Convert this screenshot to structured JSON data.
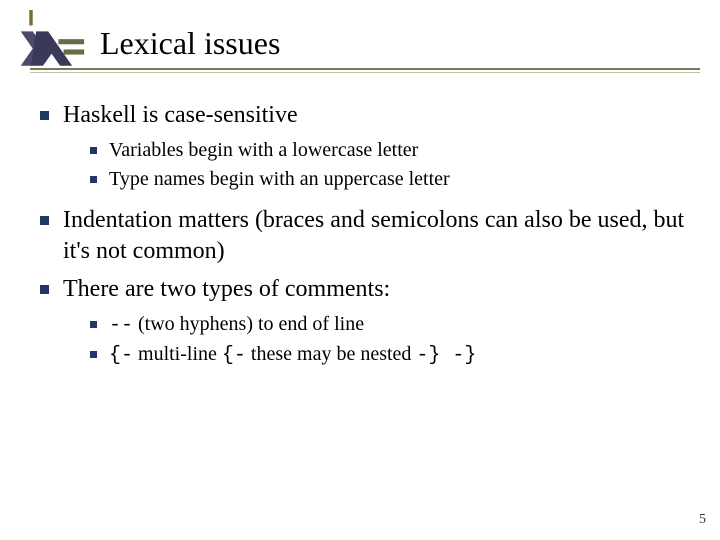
{
  "title": "Lexical issues",
  "bullets": {
    "b1": "Haskell is case-sensitive",
    "b1_1": "Variables begin with a lowercase letter",
    "b1_2": "Type names begin with an uppercase letter",
    "b2": "Indentation matters (braces and semicolons can also be used, but it's not common)",
    "b3": "There are two types of comments:",
    "b3_1_code": " --",
    "b3_1_rest": " (two hyphens) to end of line",
    "b3_2_a": "{-",
    "b3_2_b": "  multi-line ",
    "b3_2_c": "{-",
    "b3_2_d": "  these may be nested ",
    "b3_2_e": "-}  -}"
  },
  "page": "5"
}
